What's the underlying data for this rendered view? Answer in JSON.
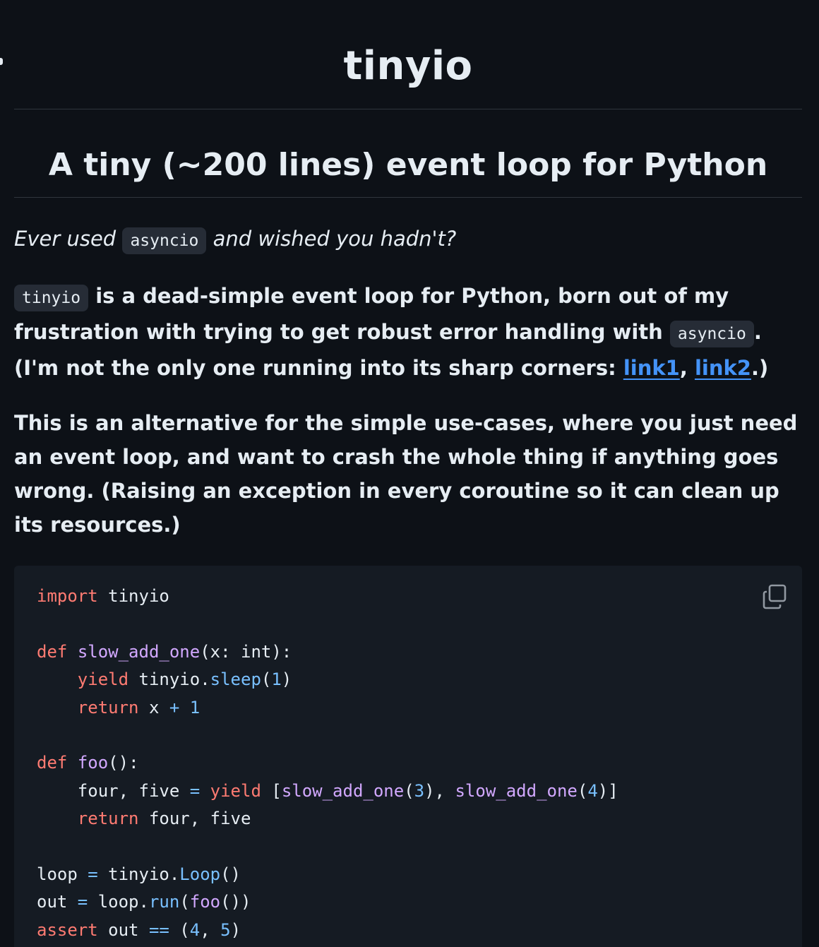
{
  "header": {
    "title": "tinyio"
  },
  "section": {
    "heading": "A tiny (~200 lines) event loop for Python"
  },
  "intro": {
    "before": "Ever used ",
    "code": "asyncio",
    "after": " and wished you hadn't?"
  },
  "para1": {
    "code1": "tinyio",
    "text1": " is a dead-simple event loop for Python, born out of my frustration with trying to get robust error handling with ",
    "code2": "asyncio",
    "text2": ". (I'm not the only one running into its sharp corners: ",
    "link1": "link1",
    "sep": ", ",
    "link2": "link2",
    "text3": ".)"
  },
  "para2": {
    "text": "This is an alternative for the simple use-cases, where you just need an event loop, and want to crash the whole thing if anything goes wrong. (Raising an exception in every coroutine so it can clean up its resources.)"
  },
  "code": {
    "copy_icon": "copy-icon",
    "tokens": {
      "l1_import": "import",
      "l1_mod": " tinyio",
      "l3_def": "def",
      "l3_fn": "slow_add_one",
      "l3_rest": "(x: int):",
      "l4_yield": "yield",
      "l4_mod": " tinyio.",
      "l4_sleep": "sleep",
      "l4_p1": "(",
      "l4_num": "1",
      "l4_p2": ")",
      "l5_return": "return",
      "l5_x": " x ",
      "l5_plus": "+",
      "l5_sp": " ",
      "l5_num": "1",
      "l7_def": "def",
      "l7_fn": "foo",
      "l7_rest": "():",
      "l8_vars": "four, five ",
      "l8_eq": "=",
      "l8_sp": " ",
      "l8_yield": "yield",
      "l8_b1": " [",
      "l8_fn1": "slow_add_one",
      "l8_p1": "(",
      "l8_n1": "3",
      "l8_p2": "), ",
      "l8_fn2": "slow_add_one",
      "l8_p3": "(",
      "l8_n2": "4",
      "l8_p4": ")]",
      "l9_return": "return",
      "l9_rest": " four, five",
      "l11_var": "loop ",
      "l11_eq": "=",
      "l11_mod": " tinyio.",
      "l11_cls": "Loop",
      "l11_p": "()",
      "l12_var": "out ",
      "l12_eq": "=",
      "l12_obj": " loop.",
      "l12_run": "run",
      "l12_p1": "(",
      "l12_fn": "foo",
      "l12_p2": "())",
      "l13_assert": "assert",
      "l13_var": " out ",
      "l13_eq": "==",
      "l13_p1": " (",
      "l13_n1": "4",
      "l13_c": ", ",
      "l13_n2": "5",
      "l13_p2": ")"
    }
  }
}
